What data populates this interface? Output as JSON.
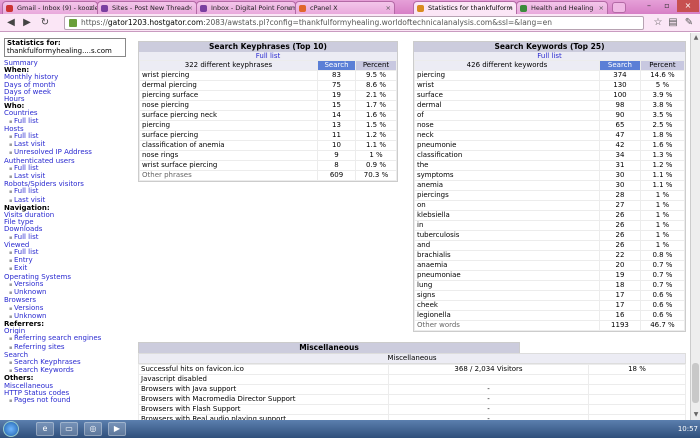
{
  "browser": {
    "tabs": [
      {
        "label": "Gmail - Inbox (9) - koozle"
      },
      {
        "label": "Sites - Post New Thread"
      },
      {
        "label": "Inbox - Digital Point Forum"
      },
      {
        "label": "cPanel X"
      },
      {
        "label": "Statistics for thankfulform"
      },
      {
        "label": "Health and Healing"
      }
    ],
    "url_prefix": "https://",
    "url_host": "gator1203.hostgator.com",
    "url_rest": ":2083/awstats.pl?config=thankfulformyhealing.worldoftechnicalanalysis.com&ssl=&lang=en"
  },
  "menu": {
    "stats_for_label": "Statistics for:",
    "stats_for_value": "thankfulformyhealing....s.com",
    "summary": "Summary",
    "when": "When:",
    "monthly": "Monthly history",
    "days_month": "Days of month",
    "days_week": "Days of week",
    "hours": "Hours",
    "who": "Who:",
    "countries": "Countries",
    "full_list": "Full list",
    "hosts": "Hosts",
    "last_visit": "Last visit",
    "unresolved": "Unresolved IP Address",
    "auth_users": "Authenticated users",
    "robots": "Robots/Spiders visitors",
    "navigation": "Navigation:",
    "visits_duration": "Visits duration",
    "file_type": "File type",
    "downloads": "Downloads",
    "viewed": "Viewed",
    "entry": "Entry",
    "exit": "Exit",
    "os": "Operating Systems",
    "versions": "Versions",
    "unknown": "Unknown",
    "browsers": "Browsers",
    "referrers": "Referrers:",
    "origin": "Origin",
    "ref_search": "Referring search engines",
    "ref_sites": "Referring sites",
    "search": "Search",
    "search_keyphrases": "Search Keyphrases",
    "search_keywords": "Search Keywords",
    "others": "Others:",
    "miscellaneous": "Miscellaneous",
    "http_status": "HTTP Status codes",
    "pages_not_found": "Pages not found"
  },
  "keyphrases": {
    "title": "Search Keyphrases (Top 10)",
    "full_list": "Full list",
    "count_label": "322 different keyphrases",
    "col_search": "Search",
    "col_percent": "Percent",
    "rows": [
      {
        "k": "wrist piercing",
        "s": "83",
        "p": "9.5 %"
      },
      {
        "k": "dermal piercing",
        "s": "75",
        "p": "8.6 %"
      },
      {
        "k": "piercing surface",
        "s": "19",
        "p": "2.1 %"
      },
      {
        "k": "nose piercing",
        "s": "15",
        "p": "1.7 %"
      },
      {
        "k": "surface piercing neck",
        "s": "14",
        "p": "1.6 %"
      },
      {
        "k": "piercing",
        "s": "13",
        "p": "1.5 %"
      },
      {
        "k": "surface piercing",
        "s": "11",
        "p": "1.2 %"
      },
      {
        "k": "classification of anemia",
        "s": "10",
        "p": "1.1 %"
      },
      {
        "k": "nose rings",
        "s": "9",
        "p": "1 %"
      },
      {
        "k": "wrist surface piercing",
        "s": "8",
        "p": "0.9 %"
      }
    ],
    "other": {
      "k": "Other phrases",
      "s": "609",
      "p": "70.3 %"
    }
  },
  "keywords": {
    "title": "Search Keywords (Top 25)",
    "full_list": "Full list",
    "count_label": "426 different keywords",
    "col_search": "Search",
    "col_percent": "Percent",
    "rows": [
      {
        "k": "piercing",
        "s": "374",
        "p": "14.6 %"
      },
      {
        "k": "wrist",
        "s": "130",
        "p": "5 %"
      },
      {
        "k": "surface",
        "s": "100",
        "p": "3.9 %"
      },
      {
        "k": "dermal",
        "s": "98",
        "p": "3.8 %"
      },
      {
        "k": "of",
        "s": "90",
        "p": "3.5 %"
      },
      {
        "k": "nose",
        "s": "65",
        "p": "2.5 %"
      },
      {
        "k": "neck",
        "s": "47",
        "p": "1.8 %"
      },
      {
        "k": "pneumonie",
        "s": "42",
        "p": "1.6 %"
      },
      {
        "k": "classification",
        "s": "34",
        "p": "1.3 %"
      },
      {
        "k": "the",
        "s": "31",
        "p": "1.2 %"
      },
      {
        "k": "symptoms",
        "s": "30",
        "p": "1.1 %"
      },
      {
        "k": "anemia",
        "s": "30",
        "p": "1.1 %"
      },
      {
        "k": "piercings",
        "s": "28",
        "p": "1 %"
      },
      {
        "k": "on",
        "s": "27",
        "p": "1 %"
      },
      {
        "k": "klebsiella",
        "s": "26",
        "p": "1 %"
      },
      {
        "k": "in",
        "s": "26",
        "p": "1 %"
      },
      {
        "k": "tuberculosis",
        "s": "26",
        "p": "1 %"
      },
      {
        "k": "and",
        "s": "26",
        "p": "1 %"
      },
      {
        "k": "brachialis",
        "s": "22",
        "p": "0.8 %"
      },
      {
        "k": "anaemia",
        "s": "20",
        "p": "0.7 %"
      },
      {
        "k": "pneumoniae",
        "s": "19",
        "p": "0.7 %"
      },
      {
        "k": "lung",
        "s": "18",
        "p": "0.7 %"
      },
      {
        "k": "signs",
        "s": "17",
        "p": "0.6 %"
      },
      {
        "k": "cheek",
        "s": "17",
        "p": "0.6 %"
      },
      {
        "k": "legionella",
        "s": "16",
        "p": "0.6 %"
      }
    ],
    "other": {
      "k": "Other words",
      "s": "1193",
      "p": "46.7 %"
    }
  },
  "misc": {
    "title": "Miscellaneous",
    "subheader": "Miscellaneous",
    "rows": [
      {
        "k": "Successful hits on favicon.ico",
        "v": "368 / 2,034 Visitors",
        "p": "18 %"
      },
      {
        "k": "Javascript disabled",
        "v": "",
        "p": ""
      },
      {
        "k": "Browsers with Java support",
        "v": "-",
        "p": ""
      },
      {
        "k": "Browsers with Macromedia Director Support",
        "v": "-",
        "p": ""
      },
      {
        "k": "Browsers with Flash Support",
        "v": "-",
        "p": ""
      },
      {
        "k": "Browsers with Real audio playing support",
        "v": "-",
        "p": ""
      }
    ]
  },
  "taskbar": {
    "clock": "10:57"
  }
}
